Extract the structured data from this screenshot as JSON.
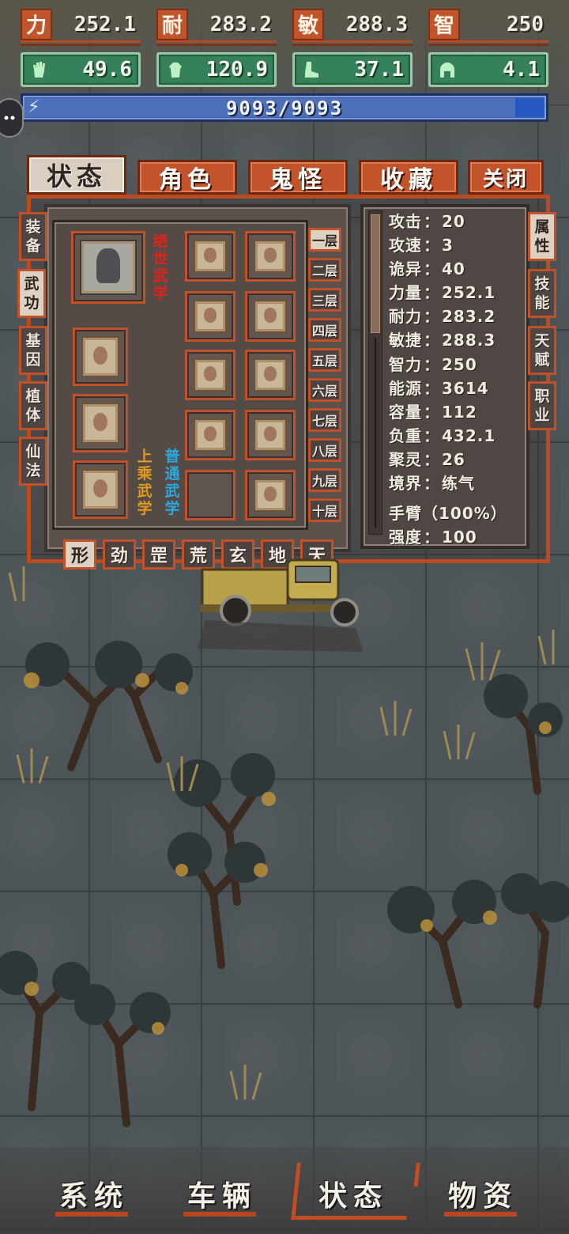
{
  "attributes": [
    {
      "key": "力",
      "value": "252.1"
    },
    {
      "key": "耐",
      "value": "283.2"
    },
    {
      "key": "敏",
      "value": "288.3"
    },
    {
      "key": "智",
      "value": "250"
    }
  ],
  "equipment": [
    {
      "icon": "hand-icon",
      "value": "49.6"
    },
    {
      "icon": "torso-icon",
      "value": "120.9"
    },
    {
      "icon": "boot-icon",
      "value": "37.1"
    },
    {
      "icon": "helmet-icon",
      "value": "4.1"
    }
  ],
  "energy": {
    "text": "9093/9093",
    "fraction": 1.0
  },
  "main_tabs": [
    "状态",
    "角色",
    "鬼怪",
    "收藏",
    "关闭"
  ],
  "active_main_tab": "状态",
  "left_tabs": [
    {
      "line1": "装",
      "line2": "备"
    },
    {
      "line1": "武",
      "line2": "功"
    },
    {
      "line1": "基",
      "line2": "因"
    },
    {
      "line1": "植",
      "line2": "体"
    },
    {
      "line1": "仙",
      "line2": "法"
    }
  ],
  "right_tabs": [
    {
      "line1": "属",
      "line2": "性"
    },
    {
      "line1": "技",
      "line2": "能"
    },
    {
      "line1": "天",
      "line2": "赋"
    },
    {
      "line1": "职",
      "line2": "业"
    }
  ],
  "floors": [
    "一层",
    "二层",
    "三层",
    "四层",
    "五层",
    "六层",
    "七层",
    "八层",
    "九层",
    "十层"
  ],
  "grades": [
    "形",
    "劲",
    "罡",
    "荒",
    "玄",
    "地",
    "天"
  ],
  "categories": {
    "peerless": {
      "c1": "绝",
      "c2": "世",
      "c3": "武",
      "c4": "学"
    },
    "superior": {
      "c1": "上",
      "c2": "乘",
      "c3": "武",
      "c4": "学"
    },
    "common": {
      "c1": "普",
      "c2": "通",
      "c3": "武",
      "c4": "学"
    }
  },
  "stats": [
    {
      "label": "攻击",
      "value": "20"
    },
    {
      "label": "攻速",
      "value": "3"
    },
    {
      "label": "诡异",
      "value": "40"
    },
    {
      "label": "力量",
      "value": "252.1"
    },
    {
      "label": "耐力",
      "value": "283.2"
    },
    {
      "label": "敏捷",
      "value": "288.3"
    },
    {
      "label": "智力",
      "value": "250"
    },
    {
      "label": "能源",
      "value": "3614"
    },
    {
      "label": "容量",
      "value": "112"
    },
    {
      "label": "负重",
      "value": "432.1"
    },
    {
      "label": "聚灵",
      "value": "26"
    },
    {
      "label": "境界",
      "value": "练气"
    }
  ],
  "body_part": {
    "text": "手臂（100%）"
  },
  "strength": {
    "label": "强度",
    "value": "100"
  },
  "separator": "：",
  "bottom_nav": [
    "系统",
    "车辆",
    "状态",
    "物资"
  ],
  "active_bottom_nav": "状态",
  "colors": {
    "accent": "#c0512a",
    "equip_green": "#35815a",
    "energy_blue": "#3c5fa9",
    "peerless_red": "#e0231b",
    "superior_orange": "#e39a1d",
    "common_blue": "#29a9de"
  }
}
